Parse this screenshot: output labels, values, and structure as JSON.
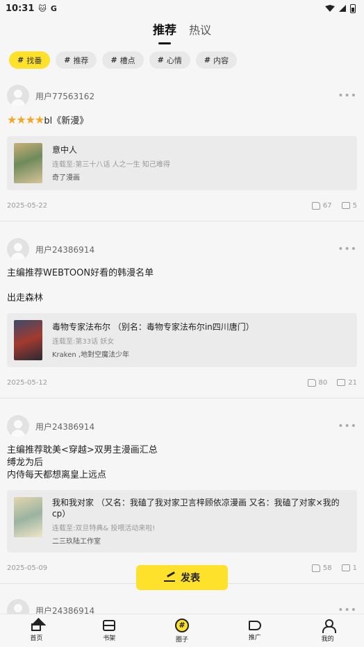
{
  "status": {
    "time": "10:31",
    "cat_icon": "cat-icon",
    "g_icon": "google-icon"
  },
  "tabs": [
    {
      "label": "推荐"
    },
    {
      "label": "热议"
    }
  ],
  "chips": [
    {
      "label": "找番"
    },
    {
      "label": "推荐"
    },
    {
      "label": "槽点"
    },
    {
      "label": "心情"
    },
    {
      "label": "内容"
    }
  ],
  "posts": [
    {
      "user": "用户77563162",
      "stars": "★★★★",
      "lines": [
        "bl《新漫》"
      ],
      "card": {
        "title": "意中人",
        "sub": "连载至:第三十八话 人之一生 知己难得",
        "author": "奇了漫画"
      },
      "date": "2025-05-22",
      "likes": "67",
      "comments": "5"
    },
    {
      "user": "用户24386914",
      "lines": [
        "主编推荐WEBTOON好看的韩漫名单",
        "",
        "出走森林"
      ],
      "card": {
        "title": "毒物专家法布尔 （别名：毒物专家法布尔in四川唐门）",
        "sub": "连载至:第33话 妖女",
        "author": "Kraken ,地對空魔法少年"
      },
      "date": "2025-05-12",
      "likes": "80",
      "comments": "21"
    },
    {
      "user": "用户24386914",
      "lines": [
        "主编推荐耽美<穿越>双男主漫画汇总",
        "缚龙为后",
        "内侍每天都想离皇上远点"
      ],
      "card": {
        "title": "我和我对家 （又名：我磕了我对家卫言梓顾依凉漫画 又名：我磕了对家×我的cp）",
        "sub": "连载至:双旦特典& 投喂活动来啦!",
        "author": "二三玖陆工作室"
      },
      "date": "2025-05-09",
      "likes": "58",
      "comments": "1"
    },
    {
      "user": "用户24386914"
    }
  ],
  "publish_label": "发表",
  "nav": [
    {
      "label": "首页",
      "icon": "home-icon"
    },
    {
      "label": "书架",
      "icon": "bookshelf-icon"
    },
    {
      "label": "圈子",
      "icon": "circle-hash-icon"
    },
    {
      "label": "推广",
      "icon": "megaphone-icon"
    },
    {
      "label": "我的",
      "icon": "profile-icon"
    }
  ],
  "colors": {
    "accent": "#fde12a",
    "background": "#f6f6f6",
    "card": "#ebebeb"
  }
}
